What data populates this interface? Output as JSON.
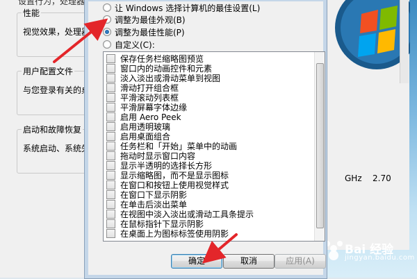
{
  "background_window": {
    "cut_text": "设置行为，处理器",
    "performance": {
      "legend": "性能",
      "desc": "视觉效果，处理器计"
    },
    "user_profiles": {
      "legend": "用户配置文件",
      "desc": "与您登录有关的桌"
    },
    "startup": {
      "legend": "启动和故障恢复",
      "desc": "系统启动、系统失"
    },
    "cpu_ghz": "GHz",
    "cpu_value": "2.70"
  },
  "dialog": {
    "radios": [
      {
        "label": "让 Windows 选择计算机的最佳设置(L)",
        "checked": false
      },
      {
        "label": "调整为最佳外观(B)",
        "checked": false
      },
      {
        "label": "调整为最佳性能(P)",
        "checked": true
      },
      {
        "label": "自定义(C):",
        "checked": false
      }
    ],
    "options": [
      "保存任务栏缩略图预览",
      "窗口内的动画控件和元素",
      "淡入淡出或滑动菜单到视图",
      "滑动打开组合框",
      "平滑滚动列表框",
      "平滑屏幕字体边缘",
      "启用 Aero Peek",
      "启用透明玻璃",
      "启用桌面组合",
      "任务栏和「开始」菜单中的动画",
      "拖动时显示窗口内容",
      "显示半透明的选择长方形",
      "显示缩略图，而不是显示图标",
      "在窗口和按钮上使用视觉样式",
      "在窗口下显示阴影",
      "在单击后淡出菜单",
      "在视图中淡入淡出或滑动工具条提示",
      "在鼠标指针下显示阴影",
      "在桌面上为图标标签使用阴影"
    ],
    "ok_label": "确定",
    "cancel_label": "取消",
    "apply_label": "应用(A)"
  },
  "watermark": {
    "text": "Bai 经验",
    "url": "jingyan.baidu.com"
  },
  "colors": {
    "arrow": "#e3262a",
    "accent": "#3c7fb1"
  }
}
